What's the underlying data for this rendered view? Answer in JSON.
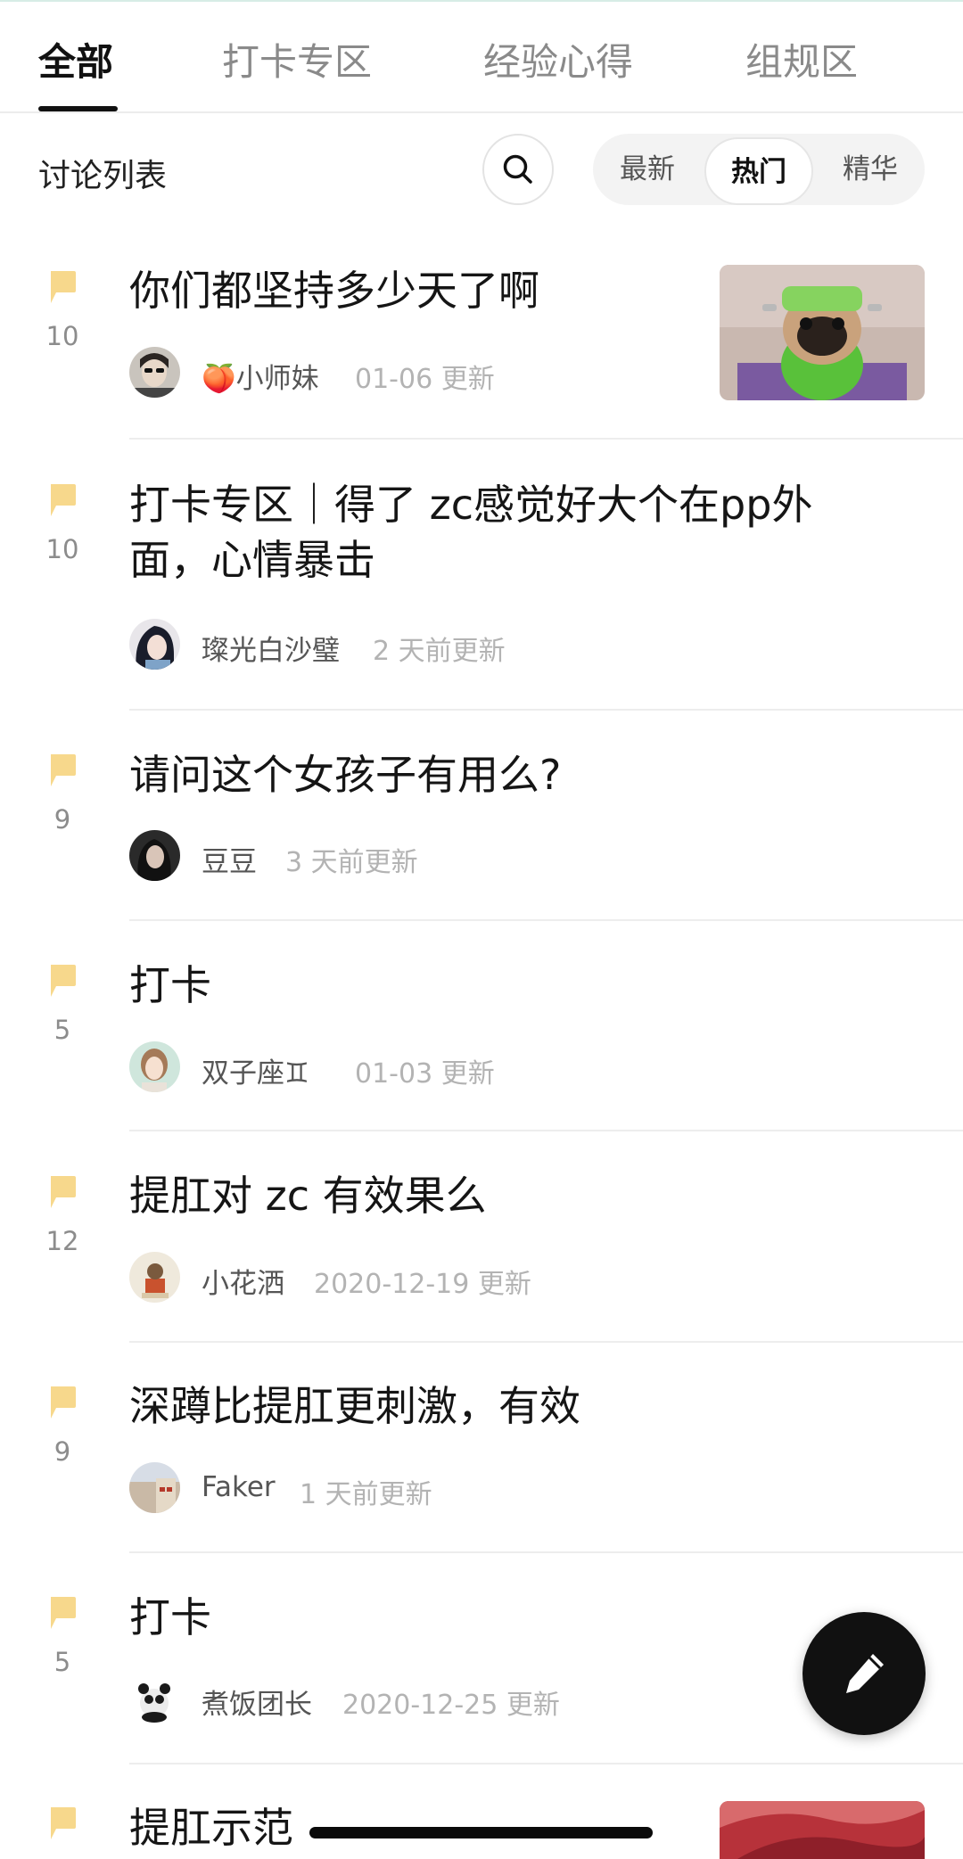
{
  "tabs": [
    {
      "label": "全部",
      "active": true
    },
    {
      "label": "打卡专区",
      "active": false
    },
    {
      "label": "经验心得",
      "active": false
    },
    {
      "label": "组规区",
      "active": false
    }
  ],
  "list_header": {
    "title": "讨论列表",
    "search_icon": "search-icon",
    "sort_options": [
      {
        "label": "最新",
        "active": false
      },
      {
        "label": "热门",
        "active": true
      },
      {
        "label": "精华",
        "active": false
      }
    ]
  },
  "posts": [
    {
      "count": "10",
      "title": "你们都坚持多少天了啊",
      "author": "🍑小师妹",
      "time": "01-06 更新",
      "has_thumb": true
    },
    {
      "count": "10",
      "title_line1": "打卡专区｜得了 zc感觉好大个在pp外",
      "title_line2": "面，心情暴击",
      "author": "璨光白沙璧",
      "time": "2 天前更新"
    },
    {
      "count": "9",
      "title": "请问这个女孩子有用么?",
      "author": "豆豆",
      "time": "3 天前更新"
    },
    {
      "count": "5",
      "title": "打卡",
      "author": "双子座♊",
      "time": "01-03 更新"
    },
    {
      "count": "12",
      "title": "提肛对 zc 有效果么",
      "author": "小花洒",
      "time": "2020-12-19 更新"
    },
    {
      "count": "9",
      "title": "深蹲比提肛更刺激，有效",
      "author": "Faker",
      "time": "1 天前更新"
    },
    {
      "count": "5",
      "title": "打卡",
      "author": "煮饭团长",
      "time": "2020-12-25 更新"
    },
    {
      "count": "",
      "title": "提肛示范",
      "author": "",
      "time": "",
      "has_thumb": true
    }
  ],
  "fab": {
    "icon": "pencil-icon"
  },
  "colors": {
    "accent_flag": "#f7d88c",
    "text_primary": "#151515",
    "text_muted": "#b3b3b3",
    "fab_bg": "#111111"
  }
}
